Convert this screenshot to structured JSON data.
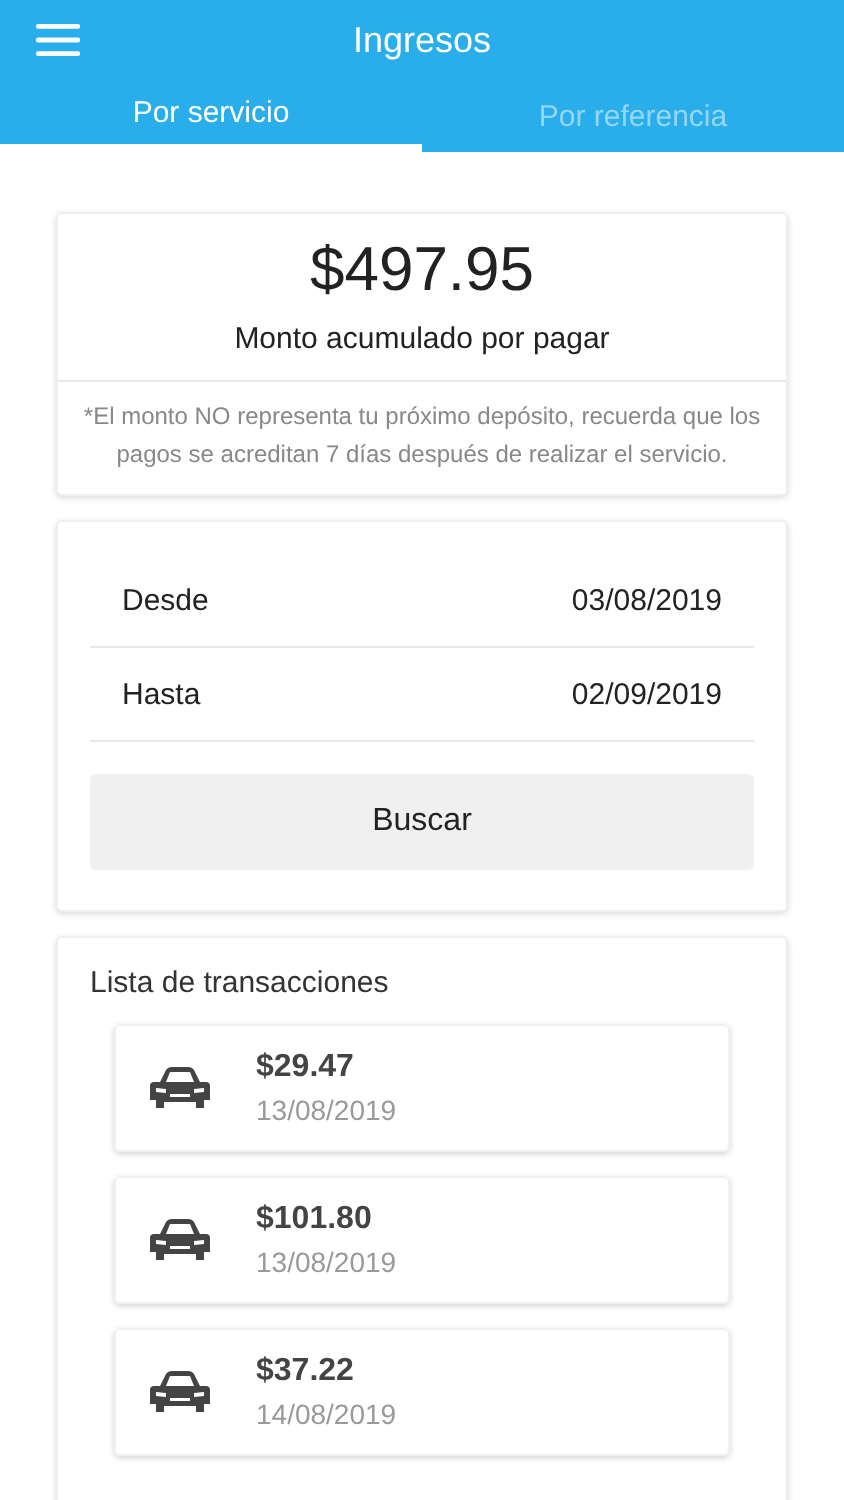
{
  "header": {
    "title": "Ingresos"
  },
  "tabs": [
    {
      "label": "Por servicio",
      "selected": true
    },
    {
      "label": "Por referencia",
      "selected": false
    }
  ],
  "summary": {
    "amount": "$497.95",
    "caption": "Monto acumulado por pagar",
    "note": "*El monto NO representa tu próximo depósito, recuerda que los pagos se acreditan 7 días después de realizar el servicio."
  },
  "filter": {
    "rows": [
      {
        "label": "Desde",
        "value": "03/08/2019"
      },
      {
        "label": "Hasta",
        "value": "02/09/2019"
      }
    ],
    "button": "Buscar"
  },
  "transactions": {
    "title": "Lista de transacciones",
    "items": [
      {
        "amount": "$29.47",
        "date": "13/08/2019"
      },
      {
        "amount": "$101.80",
        "date": "13/08/2019"
      },
      {
        "amount": "$37.22",
        "date": "14/08/2019"
      }
    ]
  }
}
